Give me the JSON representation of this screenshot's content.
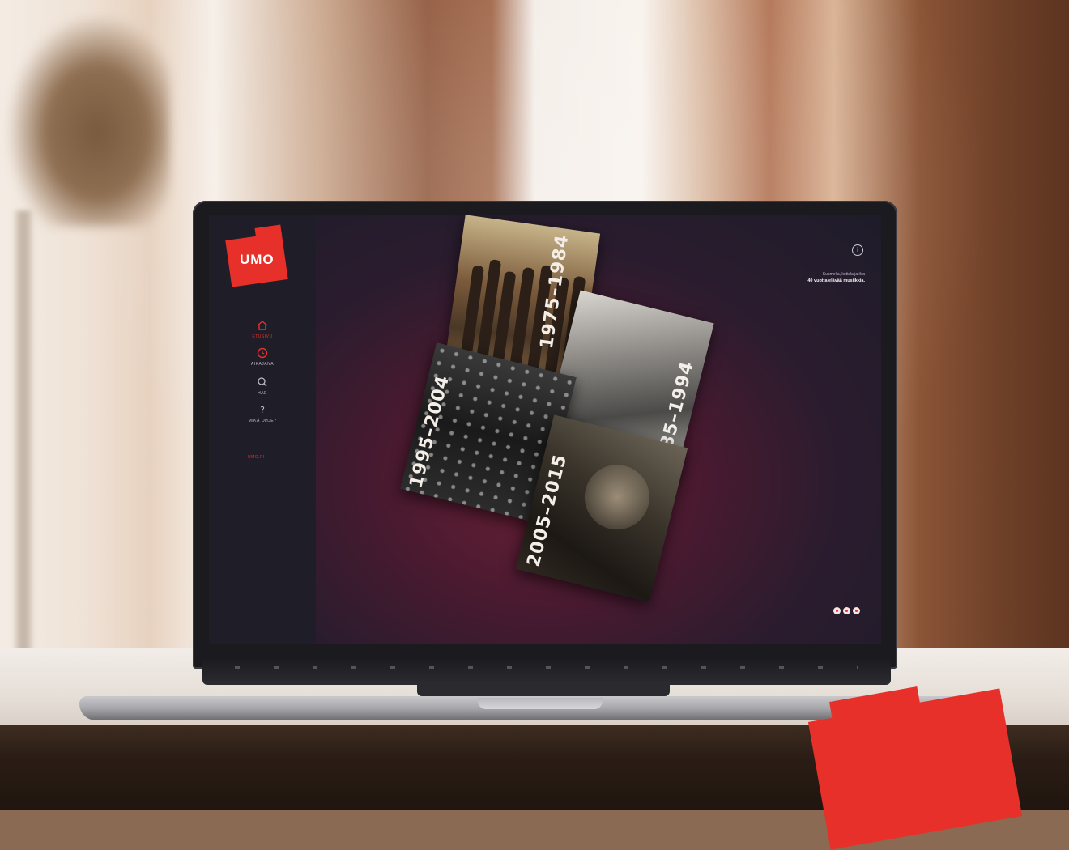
{
  "sidebar": {
    "logo": "UMO",
    "nav": [
      {
        "label": "ETUSIVU",
        "icon": "home-icon"
      },
      {
        "label": "AIKAJANA",
        "icon": "clock-icon"
      },
      {
        "label": "HAE",
        "icon": "search-icon"
      },
      {
        "label": "MIKÄ OHJE?",
        "icon": "question-icon"
      }
    ],
    "extra_link": "UMO.FI"
  },
  "stage": {
    "photos": [
      {
        "era": "1975–1984"
      },
      {
        "era": "1985–1994"
      },
      {
        "era": "1995–2004"
      },
      {
        "era": "2005–2015"
      }
    ],
    "info_icon": "info-icon",
    "tagline_line1": "Suomella, kotiala ja ilva",
    "tagline_line2": "40 vuotta elävää musiikkia."
  },
  "colors": {
    "accent": "#e8302a",
    "screen_bg": "#1e1c2a",
    "sidebar_bg": "#1f1d27"
  }
}
